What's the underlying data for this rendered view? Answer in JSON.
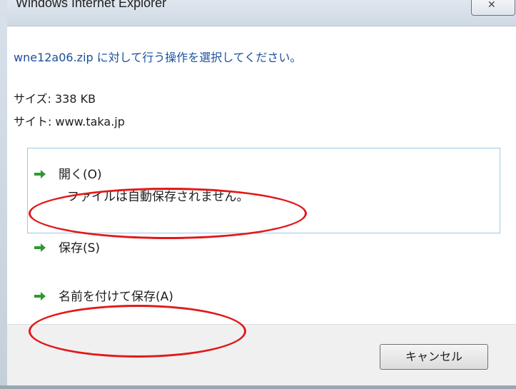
{
  "window": {
    "title": "Windows Internet Explorer",
    "close_icon": "close-icon"
  },
  "dialog": {
    "message": "wne12a06.zip に対して行う操作を選択してください。",
    "size_line": "サイズ: 338 KB",
    "site_line": "サイト: www.taka.jp"
  },
  "options": {
    "open_label": "開く(O)",
    "open_sub": "ファイルは自動保存されません。",
    "save_label": "保存(S)",
    "save_as_label": "名前を付けて保存(A)",
    "arrow_icon": "green-arrow-icon",
    "arrow_color": "#2f9a2f"
  },
  "footer": {
    "cancel_label": "キャンセル"
  },
  "annotations": {
    "color": "#e21818"
  }
}
